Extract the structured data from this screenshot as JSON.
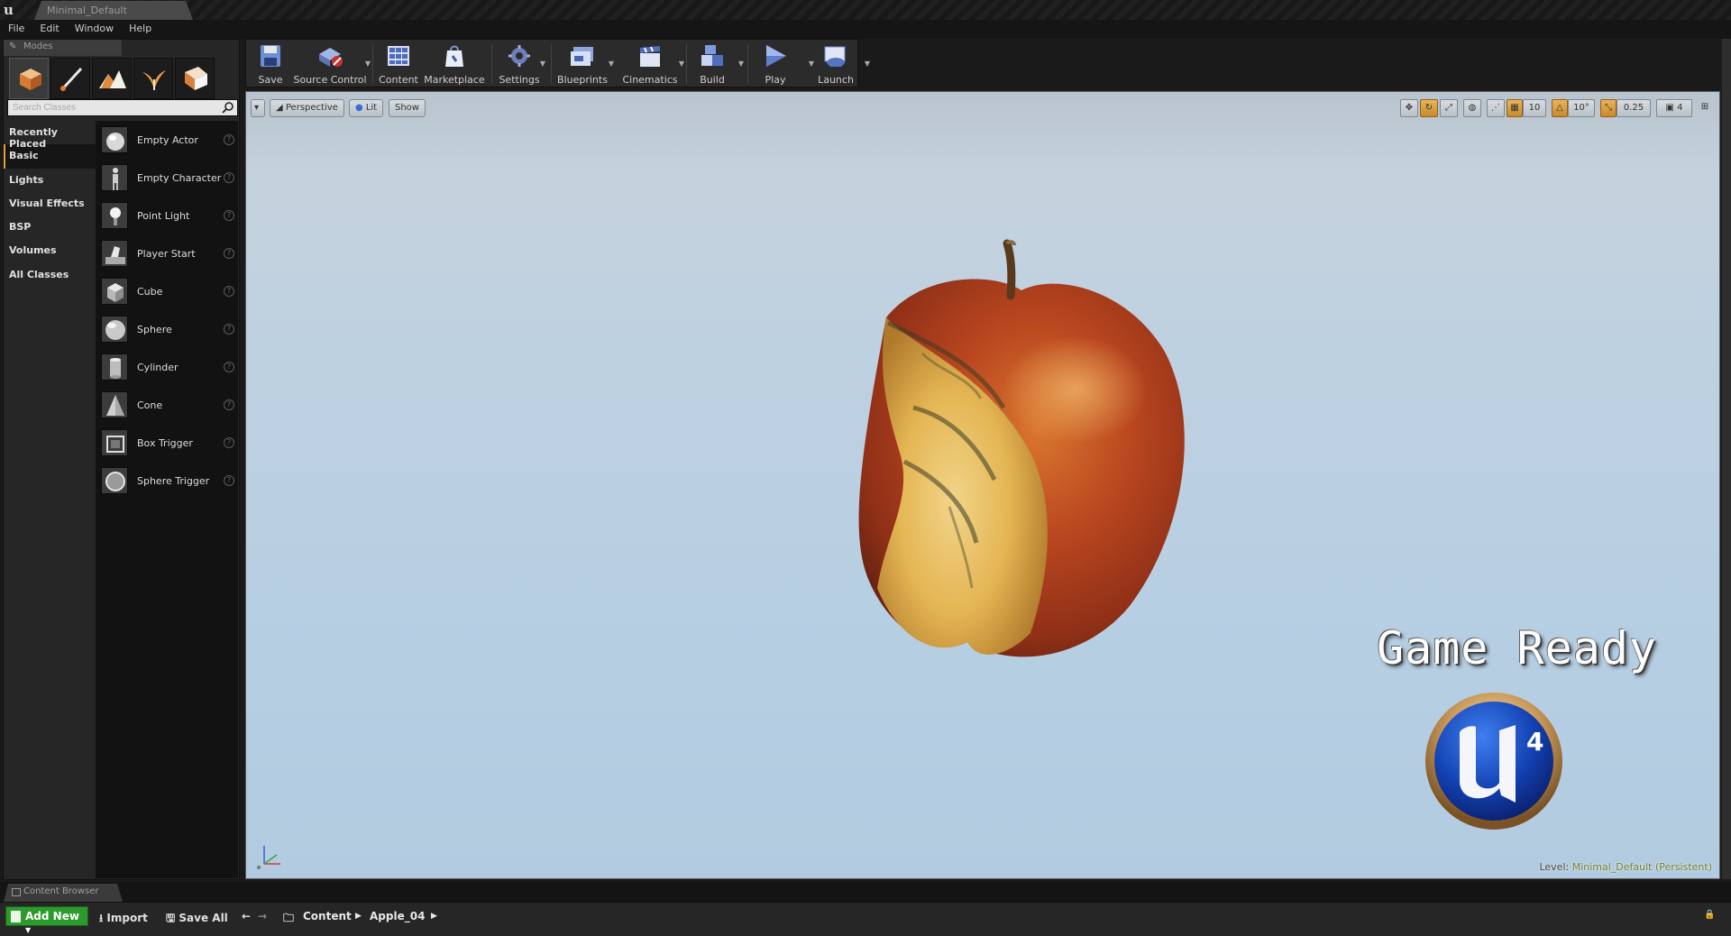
{
  "window": {
    "tab_title": "Minimal_Default"
  },
  "menu": [
    "File",
    "Edit",
    "Window",
    "Help"
  ],
  "modes": {
    "tab_label": "Modes",
    "search_placeholder": "Search Classes",
    "categories": [
      "Recently Placed",
      "Basic",
      "Lights",
      "Visual Effects",
      "BSP",
      "Volumes",
      "All Classes"
    ],
    "active_category": "Basic",
    "items": [
      "Empty Actor",
      "Empty Character",
      "Point Light",
      "Player Start",
      "Cube",
      "Sphere",
      "Cylinder",
      "Cone",
      "Box Trigger",
      "Sphere Trigger"
    ]
  },
  "toolbar": {
    "buttons": [
      "Save",
      "Source Control",
      "Content",
      "Marketplace",
      "Settings",
      "Blueprints",
      "Cinematics",
      "Build",
      "Play",
      "Launch"
    ]
  },
  "viewport": {
    "view_mode": "Perspective",
    "lighting": "Lit",
    "show_label": "Show",
    "grid_snap": "10",
    "rotation_snap": "10°",
    "scale_snap": "0.25",
    "camera_speed": "4",
    "overlay_title": "Game Ready",
    "logo_number": "4",
    "level_label": "Level:",
    "level_name": "Minimal_Default (Persistent)"
  },
  "content_browser": {
    "tab_label": "Content Browser",
    "add_new": "Add New",
    "import": "Import",
    "save_all": "Save All",
    "path": [
      "Content",
      "Apple_04"
    ]
  },
  "colors": {
    "accent": "#e0a33a",
    "add_new": "#2c9a2c",
    "toolbar_bg": "#2b2b2b"
  }
}
